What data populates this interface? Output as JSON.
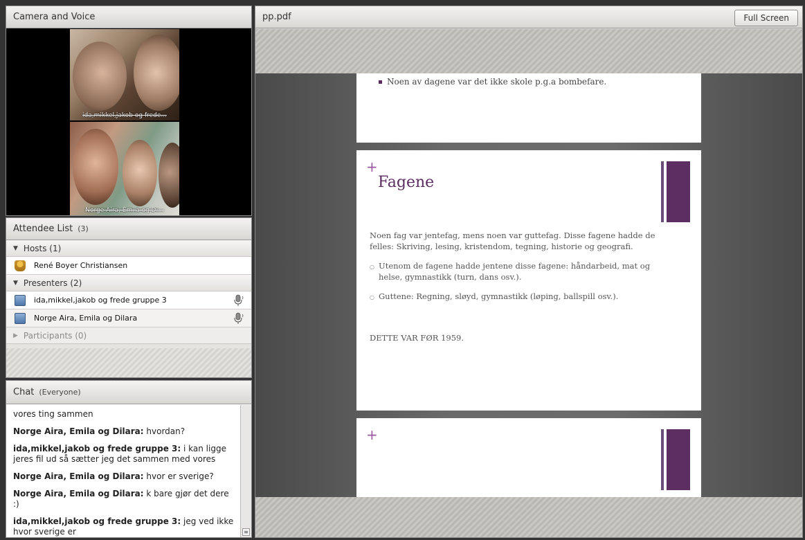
{
  "camera": {
    "title": "Camera and Voice",
    "feeds": [
      {
        "label": "ida,mikkel,jakob og frede..."
      },
      {
        "label": "Norge Aira, Emila og Di..."
      }
    ]
  },
  "attendees": {
    "title": "Attendee List",
    "count": "(3)",
    "groups": [
      {
        "label": "Hosts (1)",
        "users": [
          "René Boyer Christiansen"
        ]
      },
      {
        "label": "Presenters (2)",
        "users": [
          "ida,mikkel,jakob og frede gruppe 3",
          "Norge Aira, Emila og Dilara"
        ]
      },
      {
        "label": "Participants (0)",
        "users": []
      }
    ]
  },
  "chat": {
    "title": "Chat",
    "scope": "(Everyone)",
    "messages": [
      {
        "who": "",
        "text": "vores ting sammen"
      },
      {
        "who": "Norge Aira, Emila og Dilara:",
        "text": " hvordan?"
      },
      {
        "who": "ida,mikkel,jakob og frede gruppe 3:",
        "text": " i kan ligge jeres fil ud så sætter jeg det sammen med vores"
      },
      {
        "who": "Norge Aira, Emila og Dilara:",
        "text": " hvor er sverige?"
      },
      {
        "who": "Norge Aira, Emila og Dilara:",
        "text": " k bare gjør det dere :)"
      },
      {
        "who": "ida,mikkel,jakob og frede gruppe 3:",
        "text": " jeg ved ikke hvor sverige er"
      }
    ]
  },
  "pod": {
    "title": "pp.pdf",
    "fullscreen_label": "Full Screen"
  },
  "slides": {
    "s1_bullet": "Noen av dagene var det ikke skole p.g.a bombefare.",
    "s2_title": "Fagene",
    "s2_para": "Noen fag var jentefag, mens noen var guttefag. Disse fagene hadde de felles: Skriving, lesing, kristendom, tegning, historie og geografi.",
    "s2_sub1": "Utenom de fagene hadde jentene disse fagene: håndarbeid, mat og helse, gymnastikk (turn, dans osv.).",
    "s2_sub2": "Guttene: Regning, sløyd, gymnastikk (løping, ballspill osv.).",
    "s2_footer": "DETTE VAR FØR 1959.",
    "plus": "+"
  },
  "colors": {
    "accent_purple": "#5d2e62",
    "panel_bg": "#eceae8"
  }
}
